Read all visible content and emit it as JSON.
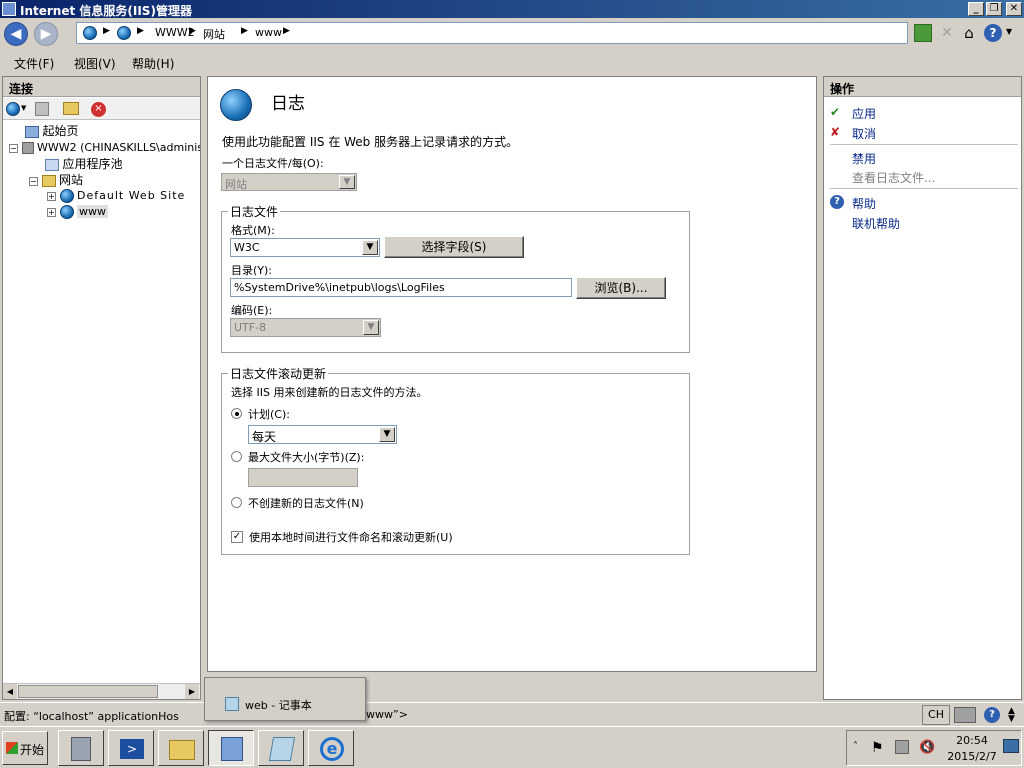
{
  "window": {
    "title": "Internet 信息服务(IIS)管理器",
    "controls": [
      "_",
      "❐",
      "✕"
    ]
  },
  "navbar": {
    "breadcrumb": [
      "WWW2",
      "网站",
      "www"
    ],
    "help_glyph": "?"
  },
  "menu": [
    "文件(F)",
    "视图(V)",
    "帮助(H)"
  ],
  "connections": {
    "header": "连接",
    "tree": [
      {
        "label": "起始页"
      },
      {
        "label": "WWW2 (CHINASKILLS\\administ"
      },
      {
        "label": "应用程序池"
      },
      {
        "label": "网站"
      },
      {
        "label": "Default Web Site"
      },
      {
        "label": "www"
      }
    ]
  },
  "main": {
    "title": "日志",
    "description": "使用此功能配置 IIS 在 Web 服务器上记录请求的方式。",
    "one_log_per_label": "一个日志文件/每(O):",
    "one_log_per_value": "网站",
    "logfile_group": {
      "legend": "日志文件",
      "format_label": "格式(M):",
      "format_value": "W3C",
      "select_fields_button": "选择字段(S)",
      "directory_label": "目录(Y):",
      "directory_value": "%SystemDrive%\\inetpub\\logs\\LogFiles",
      "browse_button": "浏览(B)...",
      "encoding_label": "编码(E):",
      "encoding_value": "UTF-8"
    },
    "rollover_group": {
      "legend": "日志文件滚动更新",
      "description": "选择 IIS 用来创建新的日志文件的方法。",
      "schedule_label": "计划(C):",
      "schedule_value": "每天",
      "max_size_label": "最大文件大小(字节)(Z):",
      "no_new_label": "不创建新的日志文件(N)",
      "local_time_label": "使用本地时间进行文件命名和滚动更新(U)",
      "local_time_checked": true,
      "selected_option": "计划(C):"
    }
  },
  "actions": {
    "header": "操作",
    "items": [
      "应用",
      "取消",
      "禁用",
      "查看日志文件...",
      "帮助",
      "联机帮助"
    ]
  },
  "statusbar": {
    "text_left": "配置: “localhost” applicationHos",
    "text_right": "www”>",
    "lang": "CH"
  },
  "tooltip": {
    "text": "web - 记事本"
  },
  "taskbar": {
    "start": "开始",
    "clock_time": "20:54",
    "clock_date": "2015/2/7"
  },
  "colors": {
    "titlebar": "#0a246a",
    "link": "#0a2a8a"
  }
}
